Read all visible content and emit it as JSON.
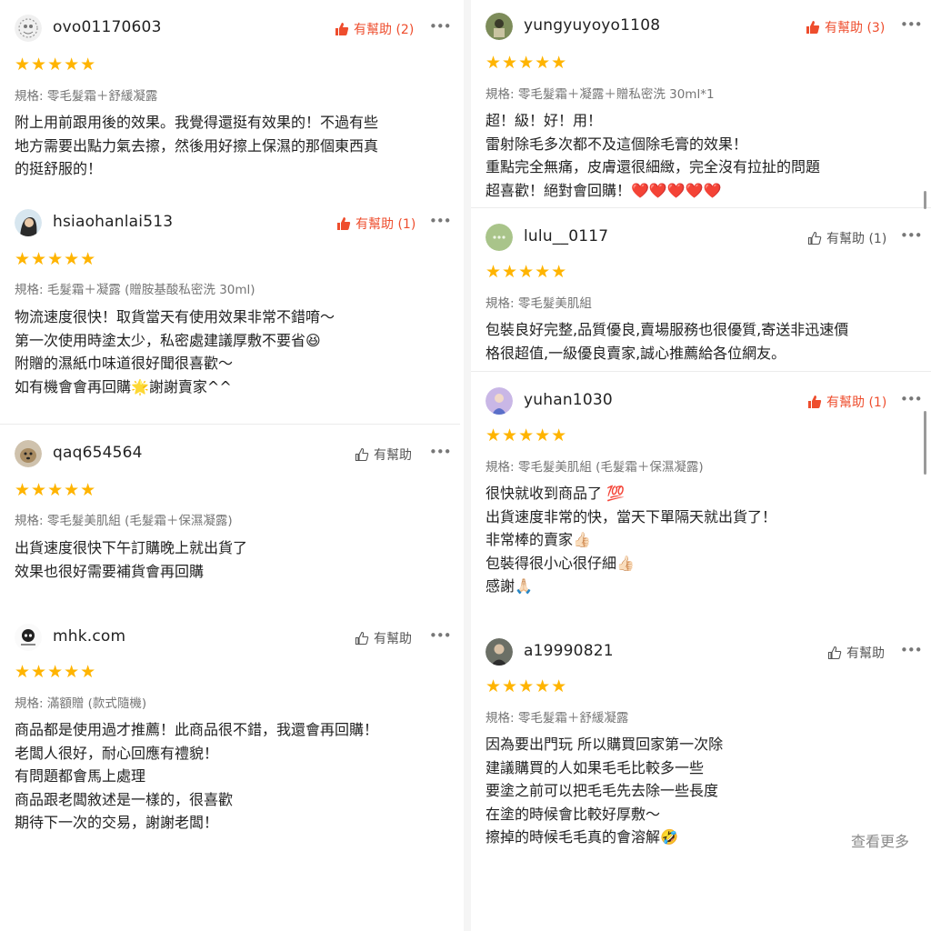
{
  "colors": {
    "accent": "#ee4d2d",
    "star": "#ffb400",
    "muted": "#757575"
  },
  "reviews_left": [
    {
      "username": "ovo01170603",
      "helpful": "有幫助 (2)",
      "helpful_active": true,
      "rating": 5,
      "spec": "規格: 零毛髮霜＋舒緩凝露",
      "body": "附上用前跟用後的效果。我覺得還挺有效果的！不過有些\n地方需要出點力氣去擦，然後用好擦上保濕的那個東西真\n的挺舒服的！"
    },
    {
      "username": "hsiaohanlai513",
      "helpful": "有幫助 (1)",
      "helpful_active": true,
      "rating": 5,
      "spec": "規格: 毛髮霜＋凝露 (贈胺基酸私密洗 30ml)",
      "body": "物流速度很快！取貨當天有使用效果非常不錯唷～\n第一次使用時塗太少，私密處建議厚敷不要省😆\n附贈的濕紙巾味道很好聞很喜歡～\n如有機會會再回購🌟謝謝賣家^^"
    },
    {
      "username": "qaq654564",
      "helpful": "有幫助",
      "helpful_active": false,
      "rating": 5,
      "spec": "規格: 零毛髮美肌組 (毛髮霜＋保濕凝露)",
      "body": "出貨速度很快下午訂購晚上就出貨了\n效果也很好需要補貨會再回購"
    },
    {
      "username": "mhk.com",
      "helpful": "有幫助",
      "helpful_active": false,
      "rating": 5,
      "spec": "規格: 滿額贈 (款式隨機)",
      "body": "商品都是使用過才推薦！此商品很不錯，我還會再回購！\n老闆人很好，耐心回應有禮貌！\n有問題都會馬上處理\n商品跟老闆敘述是一樣的，很喜歡\n期待下一次的交易，謝謝老闆！"
    }
  ],
  "reviews_right": [
    {
      "username": "yungyuyoyo1108",
      "helpful": "有幫助 (3)",
      "helpful_active": true,
      "rating": 5,
      "spec": "規格: 零毛髮霜＋凝露＋贈私密洗 30ml*1",
      "body": "超！級！好！用！\n雷射除毛多次都不及這個除毛膏的效果！\n重點完全無痛，皮膚還很細緻，完全沒有拉扯的問題\n超喜歡！絕對會回購！❤️❤️❤️❤️❤️"
    },
    {
      "username": "lulu__0117",
      "helpful": "有幫助 (1)",
      "helpful_active": false,
      "rating": 5,
      "spec": "規格: 零毛髮美肌組",
      "body": "包裝良好完整,品質優良,賣場服務也很優質,寄送非迅速價\n格很超值,一級優良賣家,誠心推薦給各位網友。"
    },
    {
      "username": "yuhan1030",
      "helpful": "有幫助 (1)",
      "helpful_active": true,
      "rating": 5,
      "spec": "規格: 零毛髮美肌組 (毛髮霜＋保濕凝露)",
      "body": "很快就收到商品了 💯\n出貨速度非常的快，當天下單隔天就出貨了！\n非常棒的賣家👍🏻\n包裝得很小心很仔細👍🏻\n感謝🙏🏻"
    },
    {
      "username": "a19990821",
      "helpful": "有幫助",
      "helpful_active": false,
      "rating": 5,
      "spec": "規格: 零毛髮霜＋舒緩凝露",
      "body": "因為要出門玩 所以購買回家第一次除\n建議購買的人如果毛毛比較多一些\n要塗之前可以把毛毛先去除一些長度\n在塗的時候會比較好厚敷～\n擦掉的時候毛毛真的會溶解🤣"
    }
  ],
  "see_more": "查看更多",
  "stars_text": "★★★★★"
}
